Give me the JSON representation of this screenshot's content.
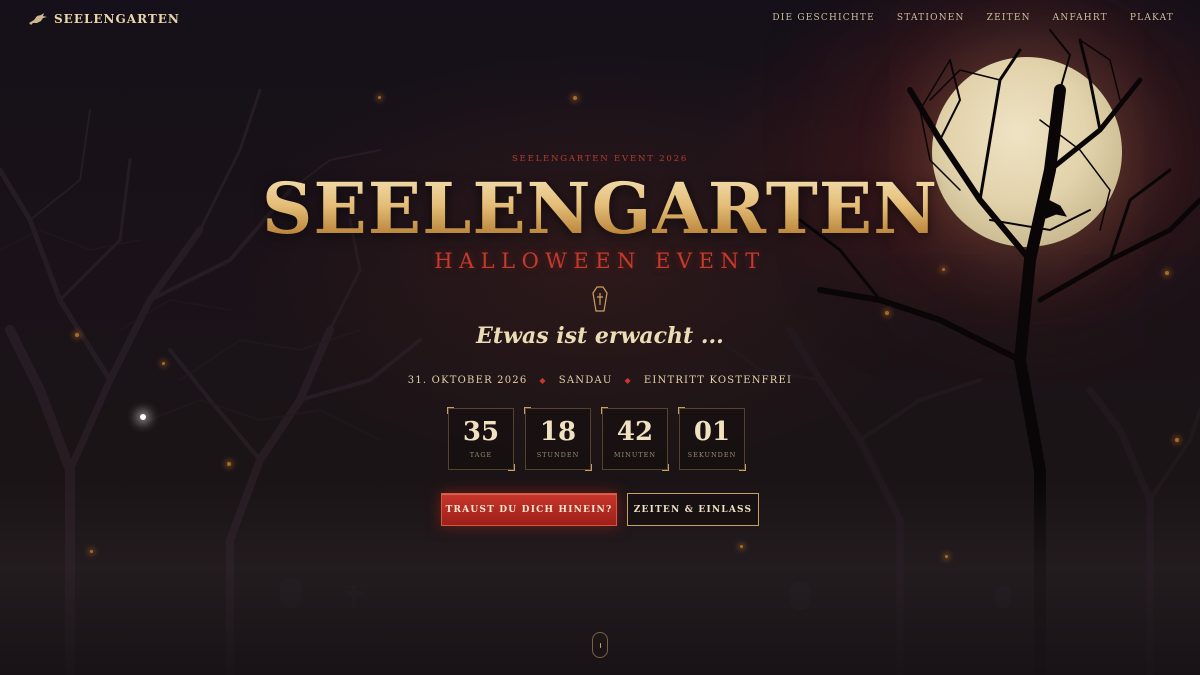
{
  "nav": {
    "logo_text": "SEELENGARTEN",
    "links": [
      "DIE GESCHICHTE",
      "STATIONEN",
      "ZEITEN",
      "ANFAHRT",
      "PLAKAT"
    ]
  },
  "hero": {
    "eyebrow": "SEELENGARTEN EVENT 2026",
    "title": "SEELENGARTEN",
    "subtitle": "HALLOWEEN EVENT",
    "tagline": "Etwas ist erwacht ...",
    "meta": [
      "31. OKTOBER 2026",
      "SANDAU",
      "EINTRITT KOSTENFREI"
    ],
    "meta_separator": "◆"
  },
  "countdown": [
    {
      "value": "35",
      "label": "TAGE"
    },
    {
      "value": "18",
      "label": "STUNDEN"
    },
    {
      "value": "42",
      "label": "MINUTEN"
    },
    {
      "value": "01",
      "label": "SEKUNDEN"
    }
  ],
  "buttons": {
    "primary": "TRAUST DU DICH HINEIN?",
    "secondary": "ZEITEN & EINLASS"
  },
  "colors": {
    "accent_red": "#c53a2c",
    "accent_gold": "#c9a060",
    "background": "#151019"
  },
  "icons": {
    "logo": "raven-icon",
    "divider": "coffin-icon",
    "scroll": "scroll-down-icon"
  }
}
